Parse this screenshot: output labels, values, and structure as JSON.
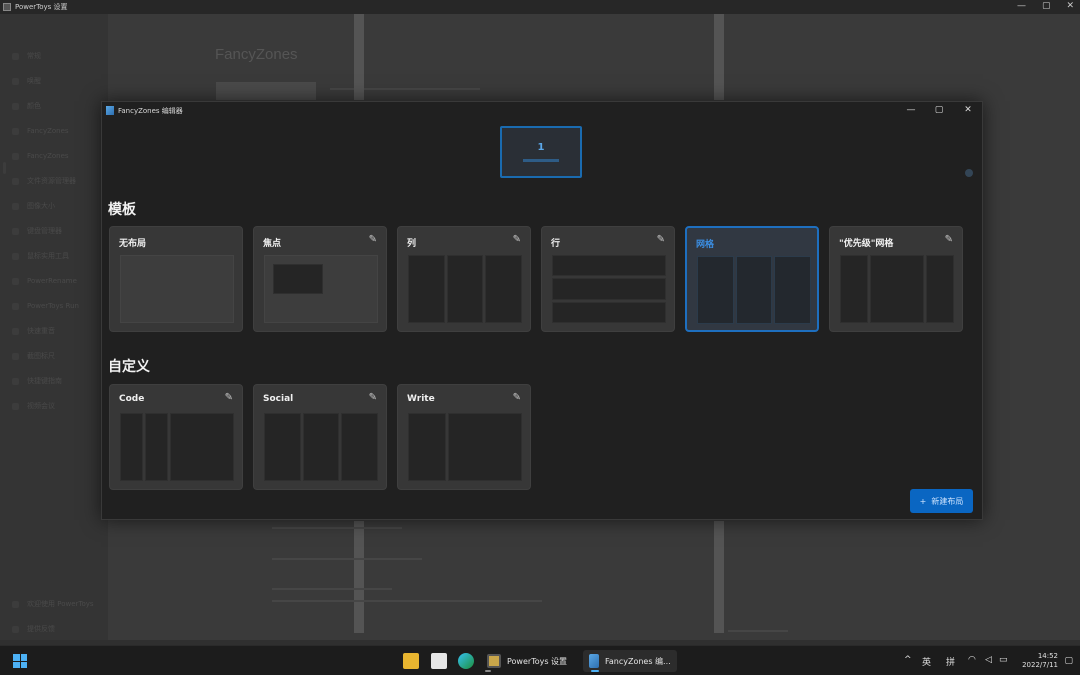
{
  "background_window": {
    "title": "PowerToys 设置",
    "content_title": "FancyZones",
    "nav_items": [
      "常规",
      "唤醒",
      "颜色",
      "FancyZones",
      "FancyZones",
      "文件资源管理器",
      "图像大小",
      "键盘管理器",
      "鼠标实用工具",
      "PowerRename",
      "PowerToys Run",
      "快速重音",
      "截图标尺",
      "快捷键指南",
      "视频会议"
    ],
    "footer_items": [
      "欢迎使用 PowerToys",
      "提供反馈"
    ],
    "controls": {
      "minimize": "—",
      "maximize": "▢",
      "close": "✕"
    }
  },
  "editor": {
    "title": "FancyZones 编辑器",
    "controls": {
      "minimize": "—",
      "maximize": "▢",
      "close": "✕"
    },
    "monitor": {
      "number": "1"
    },
    "templates_title": "模板",
    "custom_title": "自定义",
    "templates": [
      {
        "name": "无布局",
        "editable": false
      },
      {
        "name": "焦点",
        "editable": true
      },
      {
        "name": "列",
        "editable": true
      },
      {
        "name": "行",
        "editable": true
      },
      {
        "name": "网格",
        "editable": true,
        "selected": true
      },
      {
        "name": "\"优先级\"网格",
        "editable": true
      }
    ],
    "custom": [
      {
        "name": "Code",
        "editable": true
      },
      {
        "name": "Social",
        "editable": true
      },
      {
        "name": "Write",
        "editable": true
      }
    ],
    "new_layout": {
      "icon": "+",
      "label": "新建布局"
    },
    "accent": "#0a66c2"
  },
  "taskbar": {
    "apps": [
      {
        "label": "PowerToys 设置"
      },
      {
        "label": "FancyZones 编..."
      }
    ],
    "tray": {
      "chevron": "^",
      "lang1": "英",
      "lang2": "拼",
      "time": "14:52",
      "date": "2022/7/11"
    }
  }
}
